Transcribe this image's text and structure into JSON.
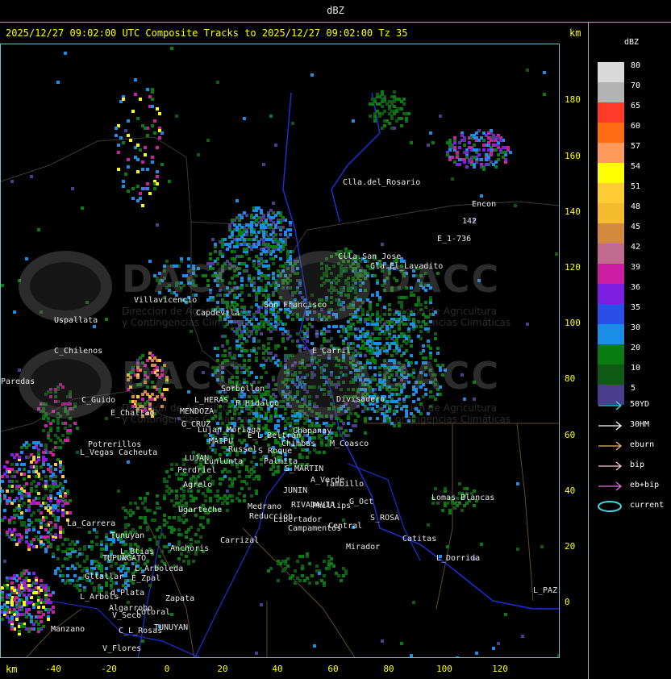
{
  "window": {
    "title": "dBZ"
  },
  "header": {
    "headline": "2025/12/27 09:02:00 UTC Composite Tracks to 2025/12/27 09:02:00 Tz 35",
    "unit_top": "km",
    "unit_bottom": "km"
  },
  "axes": {
    "y_ticks": [
      "180",
      "160",
      "140",
      "120",
      "100",
      "80",
      "60",
      "40",
      "20",
      "0"
    ],
    "x_ticks": [
      "-40",
      "-20",
      "0",
      "20",
      "40",
      "60",
      "80",
      "100",
      "120"
    ]
  },
  "legend": {
    "title": "dBZ",
    "scale": [
      {
        "label": "80",
        "color": "#d9d9d9"
      },
      {
        "label": "70",
        "color": "#b3b3b3"
      },
      {
        "label": "65",
        "color": "#ff3a28"
      },
      {
        "label": "60",
        "color": "#ff6d12"
      },
      {
        "label": "57",
        "color": "#ff9a5c"
      },
      {
        "label": "54",
        "color": "#ffff00"
      },
      {
        "label": "51",
        "color": "#ffcc33"
      },
      {
        "label": "48",
        "color": "#f5bb2e"
      },
      {
        "label": "45",
        "color": "#d38a3c"
      },
      {
        "label": "42",
        "color": "#c06a90"
      },
      {
        "label": "39",
        "color": "#cc1ea3"
      },
      {
        "label": "36",
        "color": "#7c1fe0"
      },
      {
        "label": "35",
        "color": "#2a4fe8"
      },
      {
        "label": "30",
        "color": "#1a8ee6"
      },
      {
        "label": "20",
        "color": "#0a7a12"
      },
      {
        "label": "10",
        "color": "#0e5a14"
      },
      {
        "label": "5",
        "color": "#4a3d8c"
      }
    ],
    "tracks": [
      {
        "label": "50YD",
        "color": "#45d7e0",
        "icon": "arrow-icon"
      },
      {
        "label": "30HM",
        "color": "#ffffff",
        "icon": "arrow-icon"
      },
      {
        "label": "eburn",
        "color": "#f0b77a",
        "icon": "arrow-icon"
      },
      {
        "label": "bip",
        "color": "#ffc8c8",
        "icon": "arrow-icon"
      },
      {
        "label": "eb+bip",
        "color": "#e070e0",
        "icon": "arrow-icon"
      },
      {
        "label": "current",
        "color": "#45d7e0",
        "icon": "ellipse-icon"
      }
    ]
  },
  "watermarks": {
    "brand": "DACC",
    "subtitle_line1": "Dirección de Agricultura",
    "subtitle_line2": "y Contingencias Climáticas"
  },
  "places": [
    "Clla.del_Rosario",
    "Encon",
    "142",
    "E_1-736",
    "Clla.San_Jose",
    "Gla.El_Lavadito",
    "Villavicencio",
    "Capdevila",
    "San_Francisco",
    "Uspallata",
    "C_Chilenos",
    "Paredas",
    "E_Carril",
    "Divisadero",
    "C_Guido",
    "E_Challao",
    "MENDOZA",
    "L_HERAS",
    "Sorbollon",
    "P_Hidalgo",
    "G_CRUZ",
    "Lujan_Moriaga",
    "E_L_Beltran",
    "Chimbas",
    "Chapanay",
    "M_Coasco",
    "MAIPU",
    "Russel",
    "Potrerillos",
    "L_Vegas",
    "Cacheuta",
    "LUJAN",
    "Lunlunta",
    "Perdriel",
    "S_Roque",
    "Palmita",
    "S_MARTIN",
    "Agrelo",
    "A_Verde",
    "Tambillo",
    "JUNIN",
    "Ugarteche",
    "Medrano",
    "RIVADAVIA",
    "Phillips",
    "Lomas_Blancas",
    "G_Oct",
    "S_ROSA",
    "Reduccion",
    "Libertador",
    "Campamentos",
    "La_Carrera",
    "Tunuyan",
    "Carrizal",
    "Central",
    "Catitas",
    "Anchoris",
    "L_Btias",
    "TUPUNGATO",
    "Mirador",
    "L_Dorrida",
    "L_Arboleda",
    "Gltallar",
    "E_Zpal",
    "d_Plata",
    "L_Arbols",
    "Zapata",
    "Algarrobo",
    "Manzano",
    "V_Seco",
    "Cotoral",
    "TUNUYAN",
    "C_L_Rosas",
    "V_Flores",
    "L_PAZ"
  ]
}
